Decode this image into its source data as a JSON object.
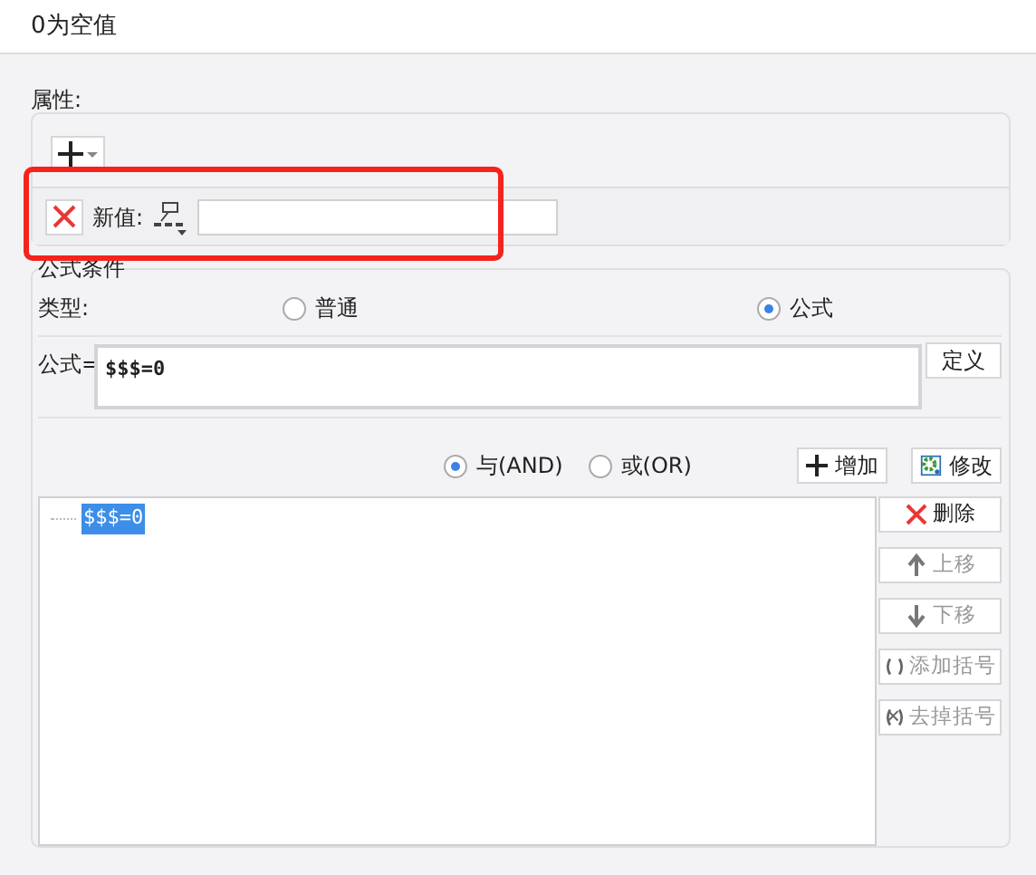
{
  "title": "0为空值",
  "properties": {
    "label": "属性:",
    "new_value_label": "新值:",
    "highlighted": true
  },
  "condition": {
    "legend": "公式条件",
    "type_label": "类型:",
    "type_options": [
      {
        "label": "普通",
        "selected": false
      },
      {
        "label": "公式",
        "selected": true
      }
    ],
    "formula_label": "公式=",
    "formula": "$$$=0",
    "define_button": "定义",
    "logic_options": [
      {
        "label": "与(AND)",
        "selected": true
      },
      {
        "label": "或(OR)",
        "selected": false
      }
    ],
    "add_button": "增加",
    "modify_button": "修改",
    "tree_items": [
      {
        "label": "$$$=0",
        "selected": true
      }
    ],
    "side_buttons": [
      {
        "kind": "delete",
        "label": "删除",
        "disabled": false
      },
      {
        "kind": "up",
        "label": "上移",
        "disabled": true
      },
      {
        "kind": "down",
        "label": "下移",
        "disabled": true
      },
      {
        "kind": "add-brackets",
        "label": "添加括号",
        "disabled": true
      },
      {
        "kind": "remove-brackets",
        "label": "去掉括号",
        "disabled": true
      }
    ]
  }
}
